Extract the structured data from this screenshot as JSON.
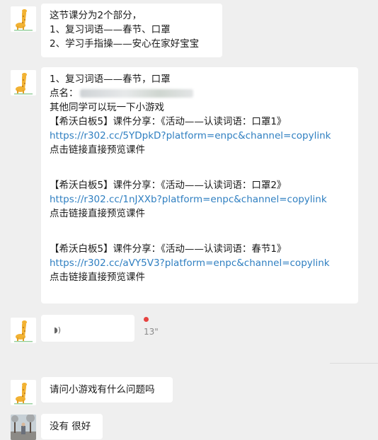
{
  "messages": {
    "m1": {
      "l1": "这节课分为2个部分，",
      "l2": "1、复习词语——春节、口罩",
      "l3": "2、学习手指操——安心在家好宝宝"
    },
    "m2": {
      "l1": "1、复习词语——春节，口罩",
      "l2": "点名：",
      "l3": "其他同学可以玩一下小游戏",
      "c1_title": "【希沃白板5】课件分享：《活动——认读词语：口罩1》",
      "c1_link": "https://r302.cc/5YDpkD?platform=enpc&channel=copylink",
      "c1_hint": "点击链接直接预览课件",
      "c2_title": "【希沃白板5】课件分享：《活动——认读词语：口罩2》",
      "c2_link": "https://r302.cc/1nJXXb?platform=enpc&channel=copylink",
      "c2_hint": "点击链接直接预览课件",
      "c3_title": "【希沃白板5】课件分享：《活动——认读词语：春节1》",
      "c3_link": "https://r302.cc/aVY5V3?platform=enpc&channel=copylink",
      "c3_hint": "点击链接直接预览课件"
    },
    "voice": {
      "icon": "voice-wave-icon",
      "duration": "13\"",
      "unread": true
    },
    "m4": {
      "text": "请问小游戏有什么问题吗"
    },
    "m5": {
      "text": "没有 很好"
    }
  },
  "colors": {
    "link": "#2f7fc1",
    "unread_dot": "#e64340",
    "bubble": "#ffffff",
    "background": "#efefef"
  },
  "icons": {
    "teacher_avatar": "giraffe-icon",
    "parent_avatar": "photo-avatar"
  }
}
